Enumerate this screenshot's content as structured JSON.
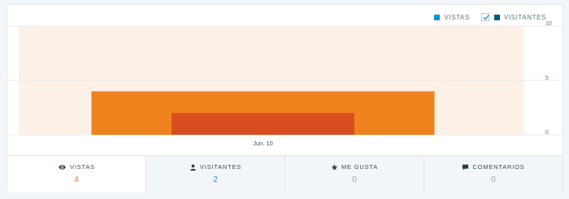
{
  "colors": {
    "vistas": "#0095dd",
    "visitantes": "#005a82",
    "plot_bg": "#fdf0e6",
    "bar_outer": "#f0821e",
    "bar_inner": "#d94e20",
    "active_value": "#e8763a",
    "visitantes_value": "#2e8ac0"
  },
  "legend": {
    "vistas_label": "VISTAS",
    "visitantes_label": "VISITANTES",
    "visitantes_checked": true
  },
  "chart_data": {
    "type": "bar",
    "categories": [
      "Jun. 10"
    ],
    "series": [
      {
        "name": "VISTAS",
        "values": [
          4
        ]
      },
      {
        "name": "VISITANTES",
        "values": [
          2
        ]
      }
    ],
    "ylim": [
      0,
      10
    ],
    "yticks": [
      "10",
      "5",
      "0"
    ]
  },
  "tabs": [
    {
      "icon": "eye-icon",
      "label": "VISTAS",
      "value": "4",
      "active": true
    },
    {
      "icon": "user-icon",
      "label": "VISITANTES",
      "value": "2",
      "active": false
    },
    {
      "icon": "star-icon",
      "label": "ME GUSTA",
      "value": "0",
      "active": false
    },
    {
      "icon": "comment-icon",
      "label": "COMENTARIOS",
      "value": "0",
      "active": false
    }
  ]
}
